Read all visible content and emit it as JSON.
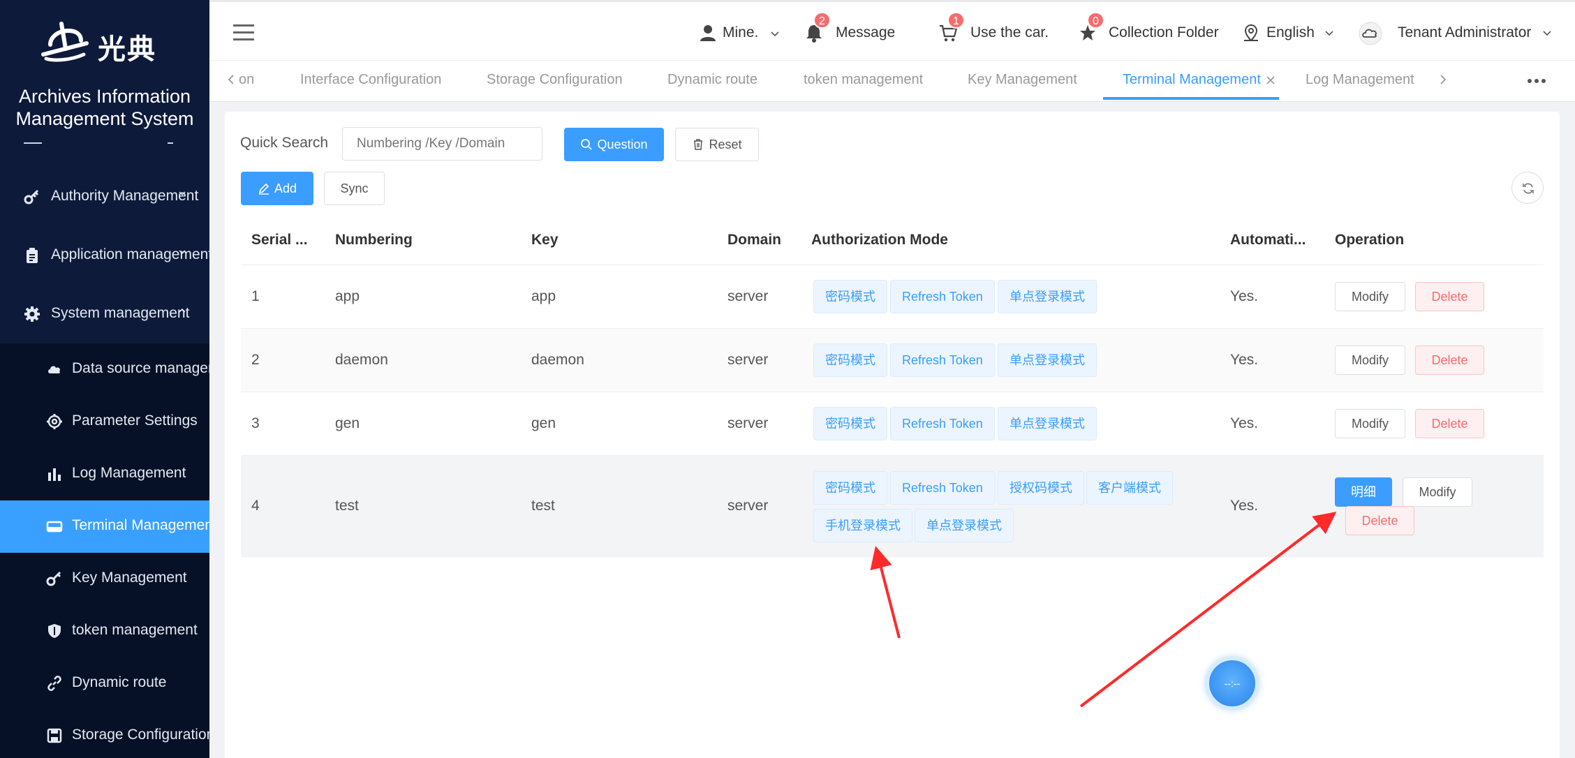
{
  "brand": {
    "logo_text": "光典",
    "system_title": "Archives Information Management System"
  },
  "sidebar": {
    "top_items": [
      {
        "label": "Authority Management",
        "icon": "key-icon"
      },
      {
        "label": "Application management",
        "icon": "clipboard-icon"
      },
      {
        "label": "System management",
        "icon": "gear-icon"
      }
    ],
    "sub_items": [
      {
        "label": "Data source management",
        "icon": "cloud-icon"
      },
      {
        "label": "Parameter Settings",
        "icon": "settings-icon"
      },
      {
        "label": "Log Management",
        "icon": "bar-chart-icon"
      },
      {
        "label": "Terminal Management",
        "icon": "terminal-icon",
        "active": true
      },
      {
        "label": "Key Management",
        "icon": "key-icon"
      },
      {
        "label": "token management",
        "icon": "shield-icon"
      },
      {
        "label": "Dynamic route",
        "icon": "link-icon"
      },
      {
        "label": "Storage Configuration",
        "icon": "save-icon"
      }
    ]
  },
  "header": {
    "mine": "Mine.",
    "message": {
      "label": "Message",
      "badge": "2"
    },
    "cart": {
      "label": "Use the car.",
      "badge": "1"
    },
    "collection": {
      "label": "Collection Folder",
      "badge": "0"
    },
    "language": "English",
    "user": "Tenant Administrator"
  },
  "tabs": {
    "partial": "on",
    "items": [
      "Interface Configuration",
      "Storage Configuration",
      "Dynamic route",
      "token management",
      "Key Management",
      "Terminal Management",
      "Log Management"
    ],
    "active": "Terminal Management"
  },
  "search": {
    "label": "Quick Search",
    "placeholder": "Numbering /Key /Domain",
    "query_button": "Question",
    "reset_button": "Reset",
    "add_button": "Add",
    "sync_button": "Sync"
  },
  "table": {
    "columns": [
      "Serial ...",
      "Numbering",
      "Key",
      "Domain",
      "Authorization Mode",
      "Automati...",
      "Operation"
    ],
    "rows": [
      {
        "serial": "1",
        "numbering": "app",
        "key": "app",
        "domain": "server",
        "modes": [
          "密码模式",
          "Refresh Token",
          "单点登录模式"
        ],
        "auto": "Yes.",
        "ops": [
          "Modify",
          "Delete"
        ]
      },
      {
        "serial": "2",
        "numbering": "daemon",
        "key": "daemon",
        "domain": "server",
        "modes": [
          "密码模式",
          "Refresh Token",
          "单点登录模式"
        ],
        "auto": "Yes.",
        "ops": [
          "Modify",
          "Delete"
        ]
      },
      {
        "serial": "3",
        "numbering": "gen",
        "key": "gen",
        "domain": "server",
        "modes": [
          "密码模式",
          "Refresh Token",
          "单点登录模式"
        ],
        "auto": "Yes.",
        "ops": [
          "Modify",
          "Delete"
        ]
      },
      {
        "serial": "4",
        "numbering": "test",
        "key": "test",
        "domain": "server",
        "modes": [
          "密码模式",
          "Refresh Token",
          "授权码模式",
          "客户端模式",
          "手机登录模式",
          "单点登录模式"
        ],
        "auto": "Yes.",
        "ops": [
          "明细",
          "Modify",
          "Delete"
        ]
      }
    ]
  },
  "float_button": {
    "label": "--:--"
  },
  "colors": {
    "sidebar_bg": "#0d1a3a",
    "submenu_bg": "#061026",
    "accent": "#3a9dff",
    "danger": "#f56c6c",
    "annotation_arrow": "#ff2a2a"
  }
}
